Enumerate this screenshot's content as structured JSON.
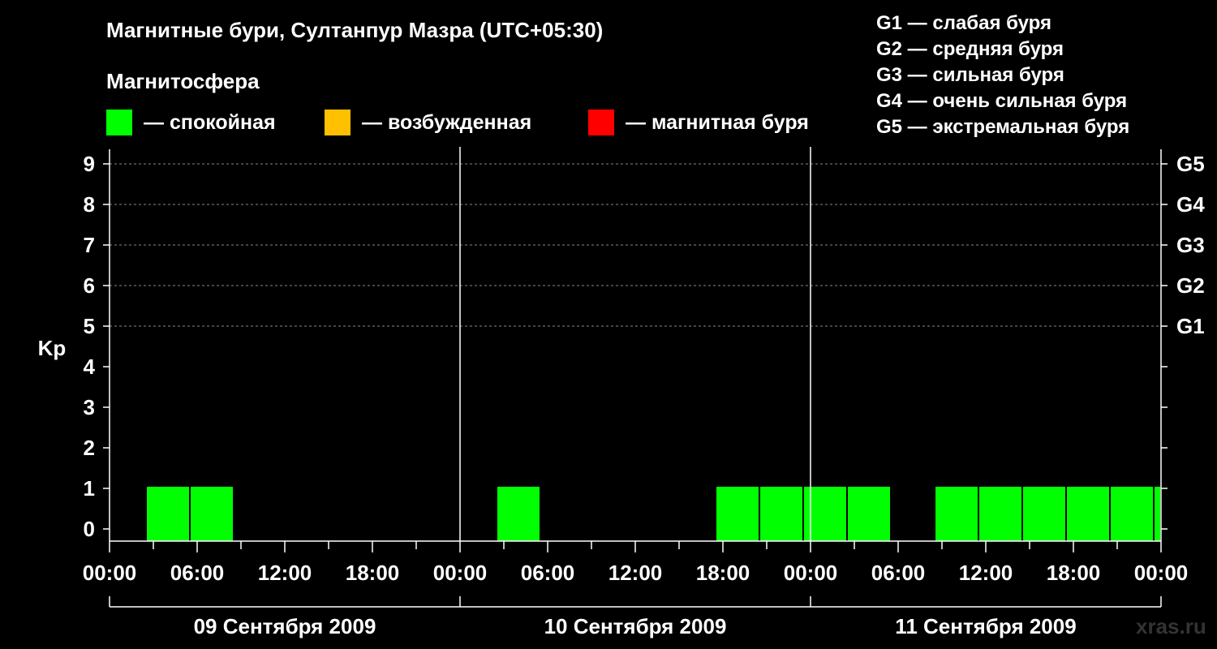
{
  "title": "Магнитные бури, Султанпур Мазра (UTC+05:30)",
  "subtitle": "Магнитосфера",
  "legend": [
    {
      "label": "— спокойная",
      "color": "#00ff00"
    },
    {
      "label": "— возбужденная",
      "color": "#ffc000"
    },
    {
      "label": "— магнитная буря",
      "color": "#ff0000"
    }
  ],
  "g_legend": [
    "G1 — слабая буря",
    "G2 — средняя буря",
    "G3 — сильная буря",
    "G4 — очень сильная буря",
    "G5 — экстремальная буря"
  ],
  "watermark": "xras.ru",
  "chart_data": {
    "type": "bar",
    "ylabel": "Kp",
    "ylim": [
      0,
      9
    ],
    "yticks": [
      "0",
      "1",
      "2",
      "3",
      "4",
      "5",
      "6",
      "7",
      "8",
      "9"
    ],
    "right_ticks": [
      {
        "kp": 5,
        "label": "G1"
      },
      {
        "kp": 6,
        "label": "G2"
      },
      {
        "kp": 7,
        "label": "G3"
      },
      {
        "kp": 8,
        "label": "G4"
      },
      {
        "kp": 9,
        "label": "G5"
      }
    ],
    "x_range_hours": [
      0,
      72
    ],
    "xtick_labels": [
      "00:00",
      "06:00",
      "12:00",
      "18:00",
      "00:00",
      "06:00",
      "12:00",
      "18:00",
      "00:00",
      "06:00",
      "12:00",
      "18:00",
      "00:00"
    ],
    "days": [
      "09 Сентября 2009",
      "10 Сентября 2009",
      "11 Сентября 2009"
    ],
    "grid": "dashed horizontal at Kp 5-9",
    "series": [
      {
        "values": [
          {
            "start": 2.5,
            "end": 5.5,
            "kp": 1,
            "color": "#00ff00"
          },
          {
            "start": 5.5,
            "end": 8.5,
            "kp": 1,
            "color": "#00ff00"
          },
          {
            "start": 26.5,
            "end": 29.5,
            "kp": 1,
            "color": "#00ff00"
          },
          {
            "start": 41.5,
            "end": 44.5,
            "kp": 1,
            "color": "#00ff00"
          },
          {
            "start": 44.5,
            "end": 47.5,
            "kp": 1,
            "color": "#00ff00"
          },
          {
            "start": 47.5,
            "end": 50.5,
            "kp": 1,
            "color": "#00ff00"
          },
          {
            "start": 50.5,
            "end": 53.5,
            "kp": 1,
            "color": "#00ff00"
          },
          {
            "start": 56.5,
            "end": 59.5,
            "kp": 1,
            "color": "#00ff00"
          },
          {
            "start": 59.5,
            "end": 62.5,
            "kp": 1,
            "color": "#00ff00"
          },
          {
            "start": 62.5,
            "end": 65.5,
            "kp": 1,
            "color": "#00ff00"
          },
          {
            "start": 65.5,
            "end": 68.5,
            "kp": 1,
            "color": "#00ff00"
          },
          {
            "start": 68.5,
            "end": 71.5,
            "kp": 1,
            "color": "#00ff00"
          },
          {
            "start": 71.5,
            "end": 72.0,
            "kp": 1,
            "color": "#00ff00"
          }
        ]
      }
    ]
  }
}
